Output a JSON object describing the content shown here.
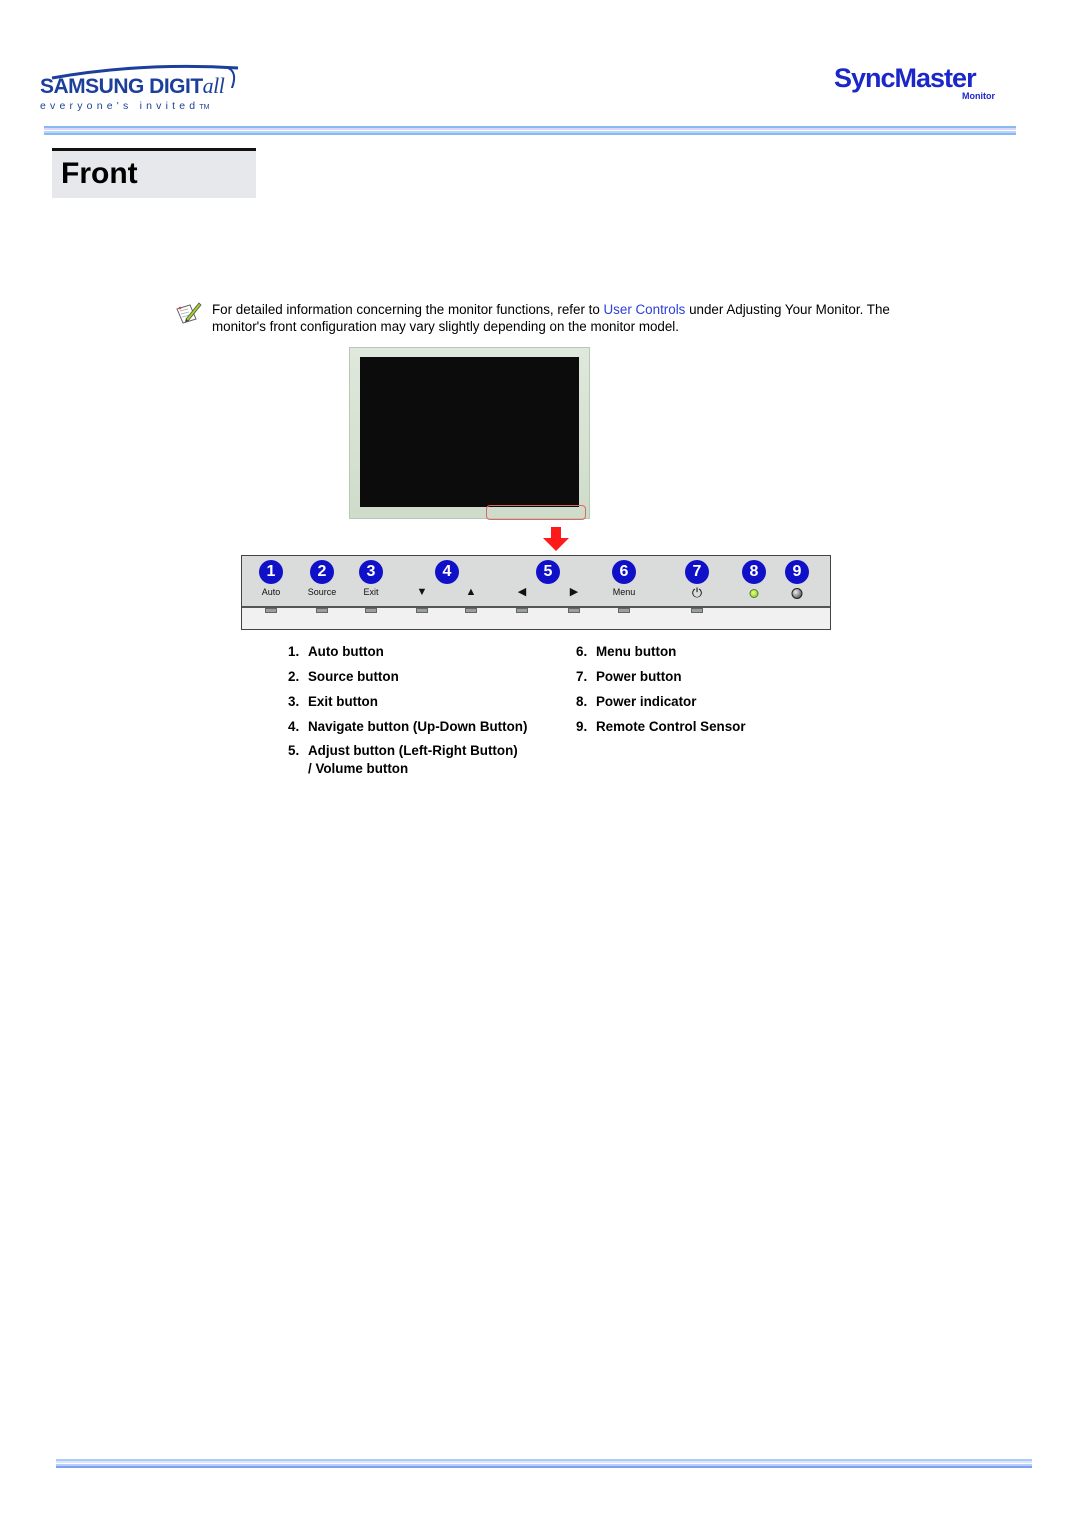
{
  "header": {
    "brand_logo": {
      "word": "SAMSUNG DIGIT",
      "word_italic": "all",
      "tagline": "everyone's invited",
      "tm": "TM"
    },
    "product_logo": {
      "word": "SyncMaster",
      "sub": "Monitor"
    }
  },
  "section": {
    "title": "Front"
  },
  "note": {
    "icon": "note-pencil-icon",
    "text_before": "For detailed information concerning the monitor functions, refer to ",
    "link_text": "User Controls",
    "text_after": " under Adjusting Your Monitor. The monitor's front configuration may vary slightly depending on the monitor model."
  },
  "colors": {
    "link": "#2a3fd6",
    "badge": "#1010c8",
    "highlight": "#e06666",
    "arrow": "#ff1a1a",
    "title_bg": "#e6e8ec",
    "rule_blue": "#8ab8f0"
  },
  "panel": {
    "controls": [
      {
        "badge": "1",
        "label": "Auto",
        "icon": null
      },
      {
        "badge": "2",
        "label": "Source",
        "icon": null
      },
      {
        "badge": "3",
        "label": "Exit",
        "icon": null
      },
      {
        "badge": "",
        "label": "",
        "icon": "▼"
      },
      {
        "badge": "4",
        "label": "",
        "icon": null
      },
      {
        "badge": "",
        "label": "",
        "icon": "▲"
      },
      {
        "badge": "",
        "label": "",
        "icon": "◀"
      },
      {
        "badge": "5",
        "label": "",
        "icon": null
      },
      {
        "badge": "",
        "label": "",
        "icon": "▶"
      },
      {
        "badge": "6",
        "label": "Menu",
        "icon": null
      },
      {
        "badge": "7",
        "label": "",
        "icon": "⏻"
      },
      {
        "badge": "8",
        "label": "",
        "icon": "led"
      },
      {
        "badge": "9",
        "label": "",
        "icon": "sensor"
      }
    ]
  },
  "legend": {
    "items": [
      {
        "num": "1.",
        "text": "Auto button"
      },
      {
        "num": "2.",
        "text": "Source button"
      },
      {
        "num": "3.",
        "text": "Exit button"
      },
      {
        "num": "4.",
        "text": "Navigate button (Up-Down Button)"
      },
      {
        "num": "5.",
        "text": "Adjust button (Left-Right Button)",
        "text2": "/ Volume button"
      },
      {
        "num": "6.",
        "text": "Menu button"
      },
      {
        "num": "7.",
        "text": "Power button"
      },
      {
        "num": "8.",
        "text": "Power indicator"
      },
      {
        "num": "9.",
        "text": "Remote Control Sensor"
      }
    ]
  }
}
